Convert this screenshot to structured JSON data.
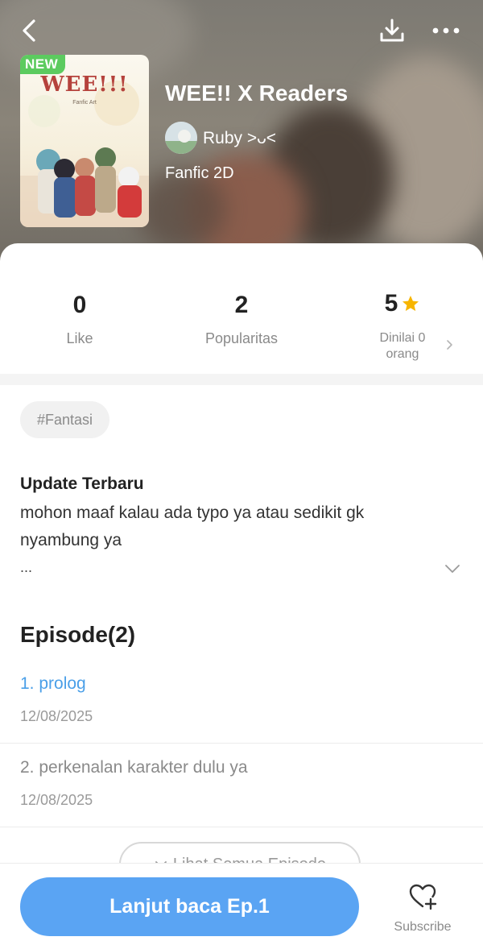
{
  "header": {
    "badge": "NEW",
    "cover_title": "WEE!!!",
    "cover_subtitle": "Fanfic Art",
    "title": "WEE!! X Readers",
    "author": "Ruby >ᴗ<",
    "genre": "Fanfic 2D"
  },
  "stats": {
    "like": {
      "value": "0",
      "label": "Like"
    },
    "popularity": {
      "value": "2",
      "label": "Popularitas"
    },
    "rating": {
      "value": "5",
      "label": "Dinilai 0 orang"
    }
  },
  "tag": "#Fantasi",
  "update": {
    "title": "Update Terbaru",
    "text": "mohon maaf kalau ada typo ya atau sedikit gk nyambung ya",
    "ellipsis": "..."
  },
  "episodes": {
    "heading": "Episode(2)",
    "items": [
      {
        "title": "1. prolog",
        "date": "12/08/2025"
      },
      {
        "title": "2. perkenalan karakter dulu ya",
        "date": "12/08/2025"
      }
    ],
    "see_all": "Lihat Semua Episode"
  },
  "bottom": {
    "continue_label": "Lanjut baca Ep.1",
    "subscribe_label": "Subscribe"
  },
  "colors": {
    "accent": "#5aa4f3",
    "link": "#4a9fe8",
    "badge": "#5ccb5f",
    "star": "#f7b500"
  }
}
